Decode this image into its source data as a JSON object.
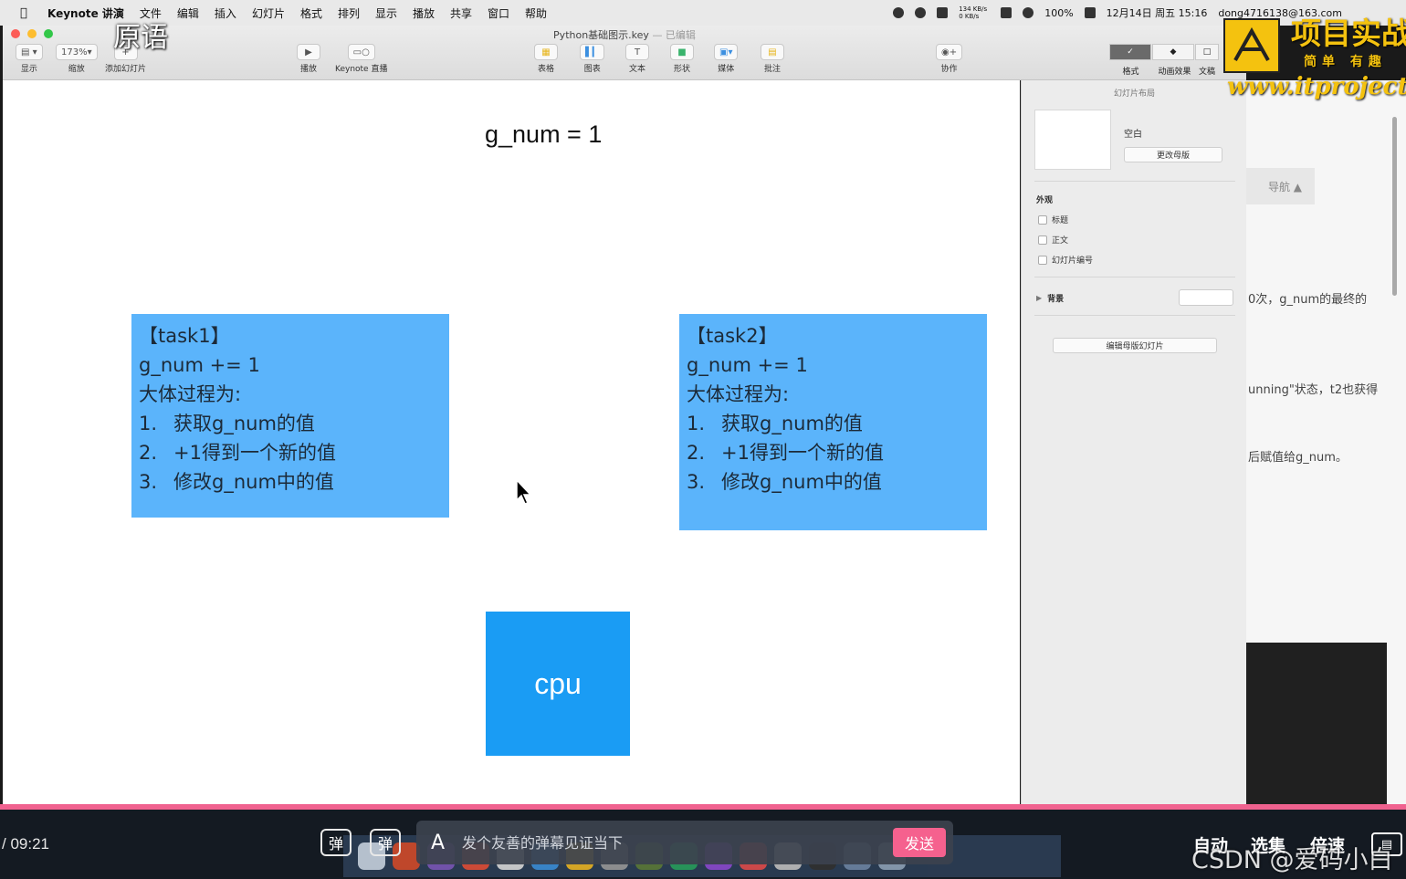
{
  "menubar": {
    "app_name": "Keynote 讲演",
    "items": [
      "文件",
      "编辑",
      "插入",
      "幻灯片",
      "格式",
      "排列",
      "显示",
      "播放",
      "共享",
      "窗口",
      "帮助"
    ],
    "net_speed": "134 KB/s 0 KB/s",
    "battery": "100%",
    "datetime": "12月14日 周五 15:16",
    "account": "dong4716138@163.com"
  },
  "window": {
    "doc_title": "Python基础图示.key",
    "edited_label": "— 已编辑"
  },
  "toolbar": {
    "view_label": "显示",
    "zoom_value": "173%",
    "zoom_label": "缩放",
    "add_slide_label": "添加幻灯片",
    "play_label": "播放",
    "keynote_live_label": "Keynote 直播",
    "table_label": "表格",
    "chart_label": "图表",
    "text_label": "文本",
    "shape_label": "形状",
    "media_label": "媒体",
    "comment_label": "批注",
    "collab_label": "协作",
    "format_label": "格式",
    "animate_label": "动画效果",
    "document_label": "文稿"
  },
  "slide": {
    "title": "g_num = 1",
    "task1": {
      "header": "【task1】",
      "stmt": "g_num += 1",
      "process": "大体过程为:",
      "steps": [
        {
          "n": "1.",
          "t": "获取g_num的值"
        },
        {
          "n": "2.",
          "t": "+1得到一个新的值"
        },
        {
          "n": "3.",
          "t": "修改g_num中的值"
        }
      ]
    },
    "task2": {
      "header": "【task2】",
      "stmt": "g_num += 1",
      "process": "大体过程为:",
      "steps": [
        {
          "n": "1.",
          "t": "获取g_num的值"
        },
        {
          "n": "2.",
          "t": "+1得到一个新的值"
        },
        {
          "n": "3.",
          "t": "修改g_num中的值"
        }
      ]
    },
    "cpu_label": "cpu"
  },
  "inspector": {
    "title": "幻灯片布局",
    "layout_name": "空白",
    "change_master": "更改母版",
    "appearance": "外观",
    "check_title": "标题",
    "check_body": "正文",
    "check_slide_number": "幻灯片编号",
    "background": "背景",
    "edit_master": "编辑母版幻灯片"
  },
  "background_page": {
    "nav": "导航 ▲",
    "snippet1": "0次，g_num的最终的",
    "snippet2": "unning\"状态，t2也获得",
    "snippet3": "后赋值给g_num。"
  },
  "overlay": {
    "original_label": "原语",
    "logo_text": "项目实战",
    "logo_sub": "简单 有趣",
    "logo_url": "www.itproject"
  },
  "player": {
    "time": "/ 09:21",
    "danmaku_toggle": "弹",
    "danmaku_settings": "弹",
    "danmaku_placeholder": "发个友善的弹幕见证当下",
    "send_label": "发送",
    "autoplay_label": "自动",
    "episodes_label": "选集",
    "speed_label": "倍速",
    "csdn_watermark": "CSDN @爱码小白"
  },
  "colors": {
    "task_box": "#5bb4fb",
    "cpu_box": "#1a9cf4",
    "progress": "#f0628f",
    "send_button": "#f5618e",
    "logo_yellow": "#f4c20f"
  }
}
